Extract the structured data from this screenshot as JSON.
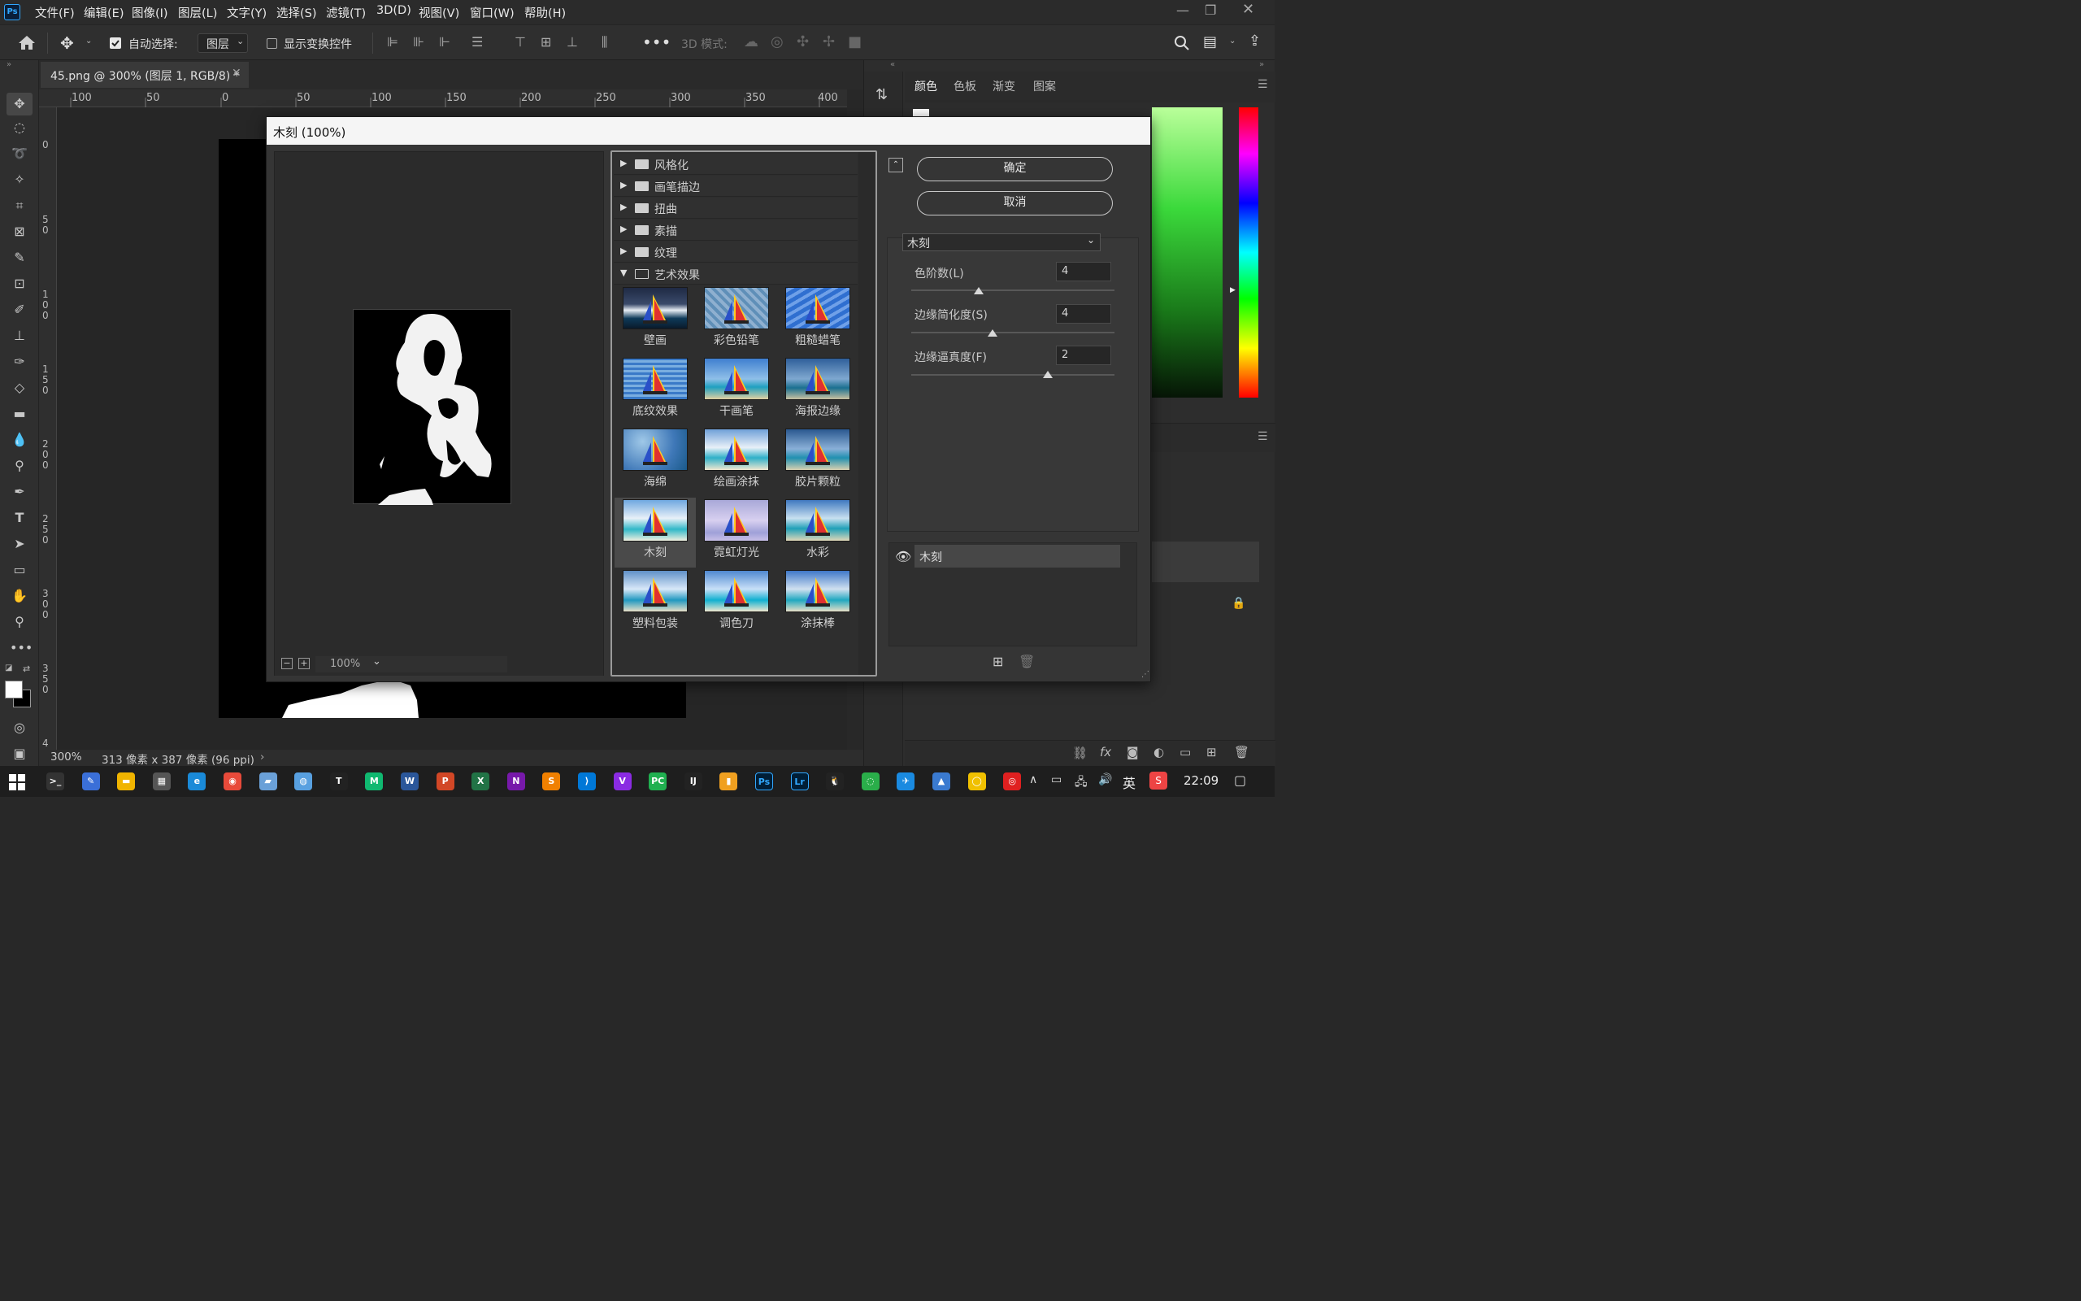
{
  "menubar": {
    "logo": "Ps",
    "items": [
      "文件(F)",
      "编辑(E)",
      "图像(I)",
      "图层(L)",
      "文字(Y)",
      "选择(S)",
      "滤镜(T)",
      "3D(D)",
      "视图(V)",
      "窗口(W)",
      "帮助(H)"
    ]
  },
  "options": {
    "auto_select_label": "自动选择:",
    "auto_select_checked": true,
    "layer_dropdown": "图层",
    "show_transform_label": "显示变换控件",
    "show_transform_checked": false,
    "mode_3d_label": "3D 模式:"
  },
  "document": {
    "tab_title": "45.png @ 300% (图层 1, RGB/8) *",
    "h_ruler_labels": [
      "100",
      "50",
      "0",
      "50",
      "100",
      "150",
      "200",
      "250",
      "300",
      "350",
      "400"
    ],
    "v_ruler_labels": [
      "0",
      "5 0",
      "1 0 0",
      "1 5 0",
      "2 0 0",
      "2 5 0",
      "3 0 0",
      "3 5 0",
      "4"
    ],
    "zoom": "300%",
    "info": "313 像素 x 387 像素 (96 ppi)"
  },
  "right_panel": {
    "tabs": [
      "颜色",
      "色板",
      "渐变",
      "图案"
    ]
  },
  "dialog": {
    "title": "木刻 (100%)",
    "preview_zoom": "100%",
    "categories": [
      {
        "label": "风格化",
        "expanded": false
      },
      {
        "label": "画笔描边",
        "expanded": false
      },
      {
        "label": "扭曲",
        "expanded": false
      },
      {
        "label": "素描",
        "expanded": false
      },
      {
        "label": "纹理",
        "expanded": false
      },
      {
        "label": "艺术效果",
        "expanded": true
      }
    ],
    "filters": [
      "壁画",
      "彩色铅笔",
      "粗糙蜡笔",
      "底纹效果",
      "干画笔",
      "海报边缘",
      "海绵",
      "绘画涂抹",
      "胶片颗粒",
      "木刻",
      "霓虹灯光",
      "水彩",
      "塑料包装",
      "调色刀",
      "涂抹棒"
    ],
    "selected_filter": "木刻",
    "ok_label": "确定",
    "cancel_label": "取消",
    "filter_select": "木刻",
    "params": [
      {
        "label": "色阶数(L)",
        "value": "4",
        "level": 0.33
      },
      {
        "label": "边缘简化度(S)",
        "value": "4",
        "level": 0.4
      },
      {
        "label": "边缘逼真度(F)",
        "value": "2",
        "level": 0.67
      }
    ],
    "effect_layer": "木刻"
  },
  "taskbar": {
    "time": "22:09",
    "ime": "英",
    "icons": [
      "terminal",
      "pen-tool",
      "file-explorer",
      "calculator",
      "edge",
      "chrome",
      "notes",
      "vpn",
      "typora",
      "mindmaster",
      "word",
      "powerpoint",
      "excel",
      "onenote",
      "sublime",
      "vscode",
      "visual-studio",
      "pycharm",
      "intellij",
      "notes-app",
      "photoshop",
      "lightroom",
      "qq",
      "wechat",
      "feishu",
      "app",
      "360",
      "netease-music"
    ]
  }
}
